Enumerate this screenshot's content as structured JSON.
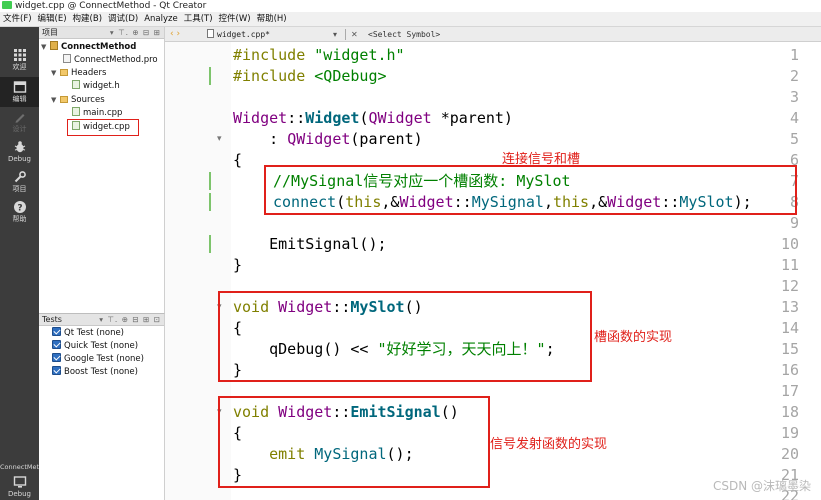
{
  "window": {
    "title": "widget.cpp @ ConnectMethod - Qt Creator"
  },
  "menubar": [
    "文件(F)",
    "编辑(E)",
    "构建(B)",
    "调试(D)",
    "Analyze",
    "工具(T)",
    "控件(W)",
    "帮助(H)"
  ],
  "modes": [
    {
      "label": "欢迎",
      "icon": "grid-icon"
    },
    {
      "label": "编辑",
      "icon": "edit-icon"
    },
    {
      "label": "设计",
      "icon": "pencil-icon"
    },
    {
      "label": "Debug",
      "icon": "bug-icon"
    },
    {
      "label": "项目",
      "icon": "wrench-icon"
    },
    {
      "label": "帮助",
      "icon": "help-icon"
    }
  ],
  "bottom_mode": {
    "kit": "ConnectMethod",
    "label": "Debug"
  },
  "project_pane": {
    "title": "项目",
    "tree": {
      "project": "ConnectMethod",
      "pro_file": "ConnectMethod.pro",
      "headers_folder": "Headers",
      "header_file": "widget.h",
      "sources_folder": "Sources",
      "source_files": [
        "main.cpp",
        "widget.cpp"
      ]
    }
  },
  "tests_pane": {
    "title": "Tests",
    "items": [
      "Qt Test (none)",
      "Quick Test (none)",
      "Google Test (none)",
      "Boost Test (none)"
    ]
  },
  "editor_toolbar": {
    "document": "widget.cpp*",
    "symbol": "<Select Symbol>"
  },
  "editor": {
    "line_numbers": [
      "1",
      "2",
      "3",
      "4",
      "5",
      "6",
      "7",
      "8",
      "9",
      "10",
      "11",
      "12",
      "13",
      "14",
      "15",
      "16",
      "17",
      "18",
      "19",
      "20",
      "21",
      "22"
    ],
    "code": {
      "l1_directive": "#include",
      "l1_file": " \"widget.h\"",
      "l2_directive": "#include",
      "l2_file": " <QDebug>",
      "l4_class": "Widget",
      "l4_sep": "::",
      "l4_ctor": "Widget",
      "l4_open": "(",
      "l4_paramtype": "QWidget",
      "l4_param": " *parent)",
      "l5_colon": "    : ",
      "l5_base": "QWidget",
      "l5_args": "(parent)",
      "l6": "{",
      "l7_comment": "//MySignal信号对应一个槽函数: MySlot",
      "l8_fn": "connect",
      "l8_open": "(",
      "l8_this1": "this",
      "l8_amp1": ",&",
      "l8_cls1": "Widget",
      "l8_sep1": "::",
      "l8_sig": "MySignal",
      "l8_comma": ",",
      "l8_this2": "this",
      "l8_amp2": ",&",
      "l8_cls2": "Widget",
      "l8_sep2": "::",
      "l8_slot": "MySlot",
      "l8_close": ");",
      "l10": "    EmitSignal();",
      "l11": "}",
      "l13_void": "void",
      "l13_cls": " Widget",
      "l13_sep": "::",
      "l13_fn": "MySlot",
      "l13_paren": "()",
      "l14": "{",
      "l15_fn": "    qDebug",
      "l15_op": "() << ",
      "l15_str": "\"好好学习，天天向上！\"",
      "l15_end": ";",
      "l16": "}",
      "l18_void": "void",
      "l18_cls": " Widget",
      "l18_sep": "::",
      "l18_fn": "EmitSignal",
      "l18_paren": "()",
      "l19": "{",
      "l20_kw": "    emit",
      "l20_sig": " MySignal",
      "l20_end": "();",
      "l21": "}"
    }
  },
  "annotations": {
    "connect_label": "连接信号和槽",
    "slot_label": "槽函数的实现",
    "emit_label": "信号发射函数的实现",
    "color": "#e0201a"
  },
  "watermark": "CSDN @沫璃墨染",
  "colors": {
    "keyword": "#808000",
    "string": "#008000",
    "type": "#800080",
    "function": "#00677c",
    "modebar": "#3c3c3c"
  }
}
